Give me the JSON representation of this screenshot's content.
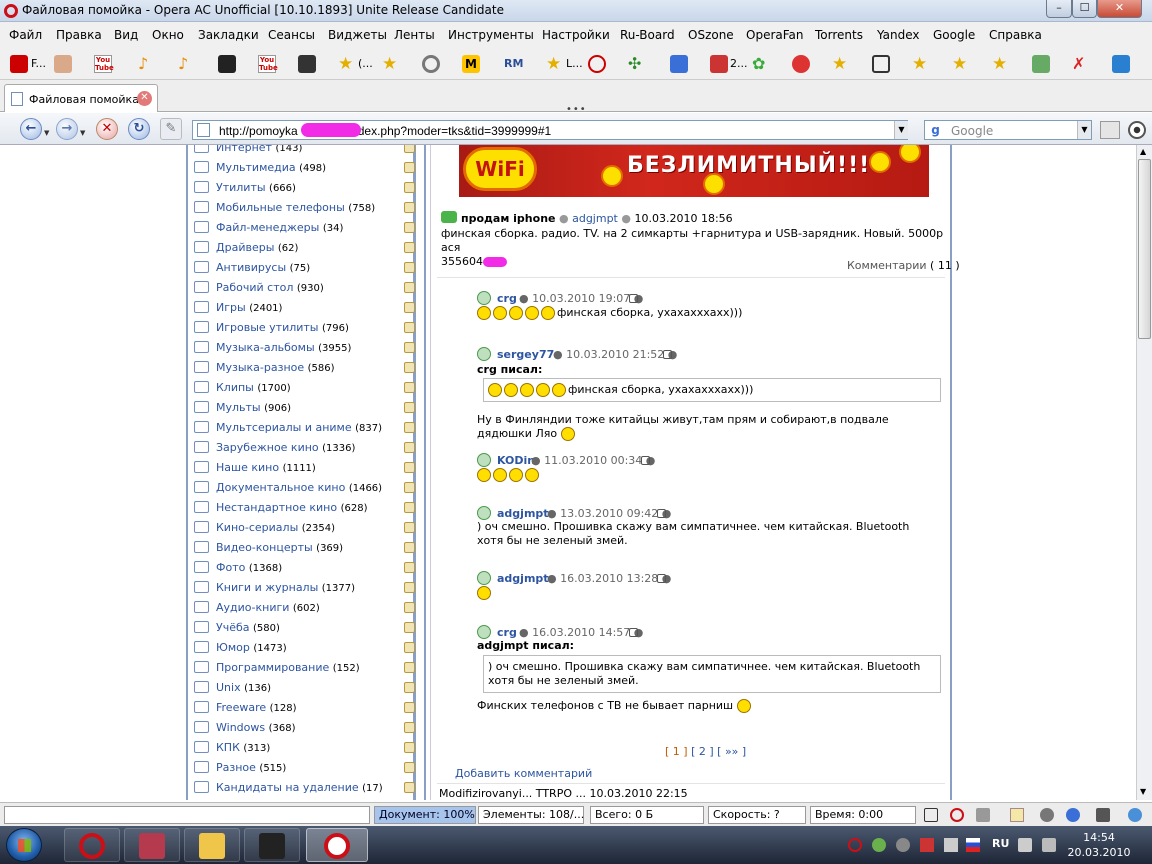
{
  "window": {
    "title": "Файловая помойка - Opera AC Unofficial [10.10.1893] Unite Release Candidate",
    "min": "–",
    "max": "☐",
    "close": "✕"
  },
  "menu": [
    "Файл",
    "Правка",
    "Вид",
    "Окно",
    "Закладки",
    "Сеансы",
    "Виджеты",
    "Ленты",
    "Инструменты",
    "Настройки",
    "Ru-Board",
    "OSzone",
    "OperaFan",
    "Torrents",
    "Yandex",
    "Google",
    "Справка"
  ],
  "bookmarks": {
    "b1": "F...",
    "b2": "(...",
    "b3": "L...",
    "b4": "2...",
    "yt": "You Tube",
    "rm": "RM",
    "m": "M"
  },
  "tab": {
    "label": "Файловая помойка",
    "close": "✕"
  },
  "tabbar_dots": "•••",
  "nav": {
    "back": "←",
    "forward": "→",
    "stop": "✕",
    "reload": "↻",
    "wand": "✎",
    "url": "http://pomoyka",
    "url_tail": "dex.php?moder=tks&tid=3999999#1",
    "search_placeholder": "Google",
    "dropdown": "▼"
  },
  "categories": [
    {
      "name": "Интернет",
      "count": "(143)"
    },
    {
      "name": "Мультимедиа",
      "count": "(498)"
    },
    {
      "name": "Утилиты",
      "count": "(666)"
    },
    {
      "name": "Мобильные телефоны",
      "count": "(758)"
    },
    {
      "name": "Файл-менеджеры",
      "count": "(34)"
    },
    {
      "name": "Драйверы",
      "count": "(62)"
    },
    {
      "name": "Антивирусы",
      "count": "(75)"
    },
    {
      "name": "Рабочий стол",
      "count": "(930)"
    },
    {
      "name": "Игры",
      "count": "(2401)"
    },
    {
      "name": "Игровые утилиты",
      "count": "(796)"
    },
    {
      "name": "Музыка-альбомы",
      "count": "(3955)"
    },
    {
      "name": "Музыка-разное",
      "count": "(586)"
    },
    {
      "name": "Клипы",
      "count": "(1700)"
    },
    {
      "name": "Мульты",
      "count": "(906)"
    },
    {
      "name": "Мультсериалы и аниме",
      "count": "(837)"
    },
    {
      "name": "Зарубежное кино",
      "count": "(1336)"
    },
    {
      "name": "Наше кино",
      "count": "(1111)"
    },
    {
      "name": "Документальное кино",
      "count": "(1466)"
    },
    {
      "name": "Нестандартное кино",
      "count": "(628)"
    },
    {
      "name": "Кино-сериалы",
      "count": "(2354)"
    },
    {
      "name": "Видео-концерты",
      "count": "(369)"
    },
    {
      "name": "Фото",
      "count": "(1368)"
    },
    {
      "name": "Книги и журналы",
      "count": "(1377)"
    },
    {
      "name": "Аудио-книги",
      "count": "(602)"
    },
    {
      "name": "Учёба",
      "count": "(580)"
    },
    {
      "name": "Юмор",
      "count": "(1473)"
    },
    {
      "name": "Программирование",
      "count": "(152)"
    },
    {
      "name": "Unix",
      "count": "(136)"
    },
    {
      "name": "Freeware",
      "count": "(128)"
    },
    {
      "name": "Windows",
      "count": "(368)"
    },
    {
      "name": "КПК",
      "count": "(313)"
    },
    {
      "name": "Разное",
      "count": "(515)"
    },
    {
      "name": "Кандидаты на удаление",
      "count": "(17)"
    }
  ],
  "banner": {
    "logo": "WiFi",
    "text": "БЕЗЛИМИТНЫЙ!!!",
    "bubble": "WiFi"
  },
  "post": {
    "title": "продам iphone",
    "author": "adgjmpt",
    "date": "10.03.2010 18:56",
    "body": "финская сборка. радио. TV. на 2 симкарты +гарнитура и USB-зарядник. Новый. 5000р ася",
    "icq": "355604",
    "comments_label": "Комментарии",
    "comments_count": "( 11 )"
  },
  "comments": [
    {
      "author": "crg",
      "date": "10.03.2010 19:07",
      "text": "финская сборка, ухахахххахх)))"
    },
    {
      "author": "sergey77",
      "date": "10.03.2010 21:52",
      "quote_label": "crg писал:",
      "quote": "финская сборка, ухахахххахх)))",
      "text": "Ну в Финляндии тоже китайцы живут,там прям и собирают,в подвале дядюшки Ляо"
    },
    {
      "author": "KODin",
      "date": "11.03.2010 00:34"
    },
    {
      "author": "adgjmpt",
      "date": "13.03.2010 09:42",
      "text": ") оч смешно. Прошивка скажу вам симпатичнее. чем китайская. Bluetooth хотя бы не зеленый змей."
    },
    {
      "author": "adgjmpt",
      "date": "16.03.2010 13:28"
    },
    {
      "author": "crg",
      "date": "16.03.2010 14:57",
      "quote_label": "adgjmpt писал:",
      "quote": ") оч смешно. Прошивка скажу вам симпатичнее. чем китайская. Bluetooth хотя бы не зеленый змей.",
      "text": "Финских телефонов с ТВ не бывает парниш"
    }
  ],
  "pager": {
    "p1": "[ 1 ]",
    "p2": "[ 2 ]",
    "next": "[ »» ]"
  },
  "add_comment": "Добавить комментарий",
  "next_post": "Modifizirovanyi... TTRPO ... 10.03.2010 22:15",
  "status": {
    "doc": "Документ:  100%",
    "elements": "Элементы:  108/...",
    "total": "Всего:   0 Б",
    "speed": "Скорость:   ?",
    "time": "Время:  0:00"
  },
  "taskbar": {
    "time": "14:54",
    "date": "20.03.2010",
    "lang": "RU"
  },
  "colors": {
    "link": "#2d55a0",
    "accent": "#cc0f16",
    "doc_field": "#a7c5ec"
  }
}
